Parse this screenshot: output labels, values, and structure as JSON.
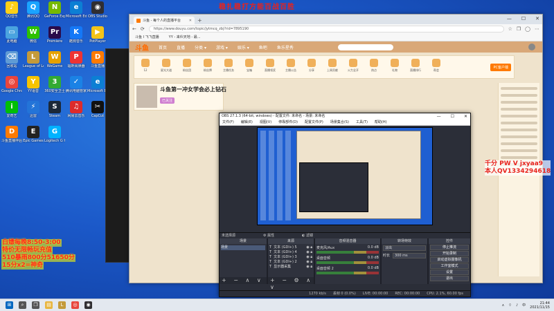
{
  "overlay": {
    "title": "稳扎稳打方能百战百胜",
    "left_lines": [
      "白嫖每晚8:50-3:00",
      "特价无限畅玩充值",
      "510暴雨800分51650分",
      "15分x2=神奇"
    ],
    "right_lines": [
      "千分 PW V jxyaa9",
      "本人QV1334294618"
    ]
  },
  "desktop_icons": [
    {
      "label": "QQ音乐",
      "color": "#fdd017",
      "glyph": "♪"
    },
    {
      "label": "腾讯QQ",
      "color": "#1aa3ff",
      "glyph": "Q"
    },
    {
      "label": "GeForce Experience",
      "color": "#76b900",
      "glyph": "N"
    },
    {
      "label": "Microsoft Edge",
      "color": "#0c7fd4",
      "glyph": "e"
    },
    {
      "label": "OBS Studio",
      "color": "#302e31",
      "glyph": "◉"
    },
    {
      "label": "此电脑",
      "color": "#4aa3df",
      "glyph": "▭"
    },
    {
      "label": "微信",
      "color": "#2dc100",
      "glyph": "W"
    },
    {
      "label": "Premiere",
      "color": "#2a0b4a",
      "glyph": "Pr"
    },
    {
      "label": "酷狗音乐",
      "color": "#1478f7",
      "glyph": "K"
    },
    {
      "label": "PotPlayer",
      "color": "#f3c318",
      "glyph": "▶"
    },
    {
      "label": "回收站",
      "color": "#5f9bd5",
      "glyph": "⌫"
    },
    {
      "label": "League of Legends",
      "color": "#c49a3a",
      "glyph": "L"
    },
    {
      "label": "WeGame",
      "color": "#e6a100",
      "glyph": "W"
    },
    {
      "label": "福昕阅读器",
      "color": "#e33",
      "glyph": "P"
    },
    {
      "label": "斗鱼直播",
      "color": "#ff7a00",
      "glyph": "D"
    },
    {
      "label": "Google Chrome",
      "color": "#e8453c",
      "glyph": "◎"
    },
    {
      "label": "YY语音",
      "color": "#f5c400",
      "glyph": "Y"
    },
    {
      "label": "360安全卫士",
      "color": "#33aa33",
      "glyph": "3"
    },
    {
      "label": "腾讯电脑管家",
      "color": "#1b82e5",
      "glyph": "✓"
    },
    {
      "label": "Microsoft Edge",
      "color": "#0c7fd4",
      "glyph": "e"
    },
    {
      "label": "爱奇艺",
      "color": "#00be06",
      "glyph": "i"
    },
    {
      "label": "迅雷",
      "color": "#2374d8",
      "glyph": "⚡"
    },
    {
      "label": "Steam",
      "color": "#1b2838",
      "glyph": "S"
    },
    {
      "label": "网易云音乐",
      "color": "#dd2b2b",
      "glyph": "♫"
    },
    {
      "label": "CapCut",
      "color": "#111",
      "glyph": "✂"
    },
    {
      "label": "斗鱼直播伴侣",
      "color": "#ff7a00",
      "glyph": "D"
    },
    {
      "label": "Epic Games",
      "color": "#222",
      "glyph": "E"
    },
    {
      "label": "Logitech G HUB",
      "color": "#00b2ff",
      "glyph": "G"
    }
  ],
  "browser": {
    "tab_title": "斗鱼 - 每个人的直播平台",
    "url": "https://www.douyu.com/topic/jytmcq_zbj?rid=7895190",
    "bookmarks": [
      "斗鱼 Ⅰ 飞飞直播",
      "YY - 来伙天地 - 最..."
    ],
    "nav": {
      "logo": "斗鱼",
      "items": [
        "首页",
        "直播",
        "分类 ▾",
        "游戏 ▾",
        "娱乐 ▾",
        "鱼吧",
        "鱼乐星秀"
      ]
    },
    "room_items": [
      "12",
      "星光大道",
      "粉丝团",
      "粉丝牌",
      "主播任务",
      "宝箱",
      "直播领奖",
      "主播公告",
      "分享",
      "上周贡献",
      "火力全开",
      "热点",
      "礼物",
      "直播排行",
      "帮会"
    ],
    "room_badge": "PC客户端",
    "streamer_name": "斗鱼第一冲女学会必上钻石",
    "streamer_follow": "已关注"
  },
  "obs": {
    "title": "OBS 27.1.3 (64-bit, windows) - 配置文件: 未命名 - 场景: 未命名",
    "menu": [
      "文件(F)",
      "编辑(E)",
      "视图(V)",
      "停靠部件(D)",
      "配置文件(P)",
      "场景集合(S)",
      "工具(T)",
      "帮助(H)"
    ],
    "scene_bar": {
      "label": "未选择源",
      "props": "属性",
      "filters": "滤镜"
    },
    "docks": {
      "scenes": {
        "title": "场景",
        "items": [
          "场景"
        ]
      },
      "sources": {
        "title": "来源",
        "items": [
          "文本 (GDI+) 5",
          "文本 (GDI+) 4",
          "文本 (GDI+) 3",
          "文本 (GDI+) 2",
          "显示器采集"
        ]
      },
      "mixer": {
        "title": "音频混音器",
        "tracks": [
          {
            "name": "麦克风/Aux",
            "db": "0.0 dB"
          },
          {
            "name": "桌面音频",
            "db": "0.0 dB"
          },
          {
            "name": "桌面音频 2",
            "db": "0.0 dB"
          }
        ]
      },
      "transitions": {
        "title": "转场特效",
        "type": "淡出",
        "duration_label": "时长",
        "duration": "300 ms"
      },
      "controls": {
        "title": "控件",
        "buttons": [
          "停止推流",
          "开始录制",
          "启动虚拟摄像机",
          "工作室模式",
          "设置",
          "退出"
        ]
      }
    },
    "status": {
      "dropped": "丢帧 0 (0.0%)",
      "live": "LIVE: 00:00:00",
      "rec": "REC: 00:00:00",
      "cpu": "CPU: 2.1%, 60.00 fps",
      "kbps": "1270 kb/s"
    }
  },
  "taskbar": {
    "icons": [
      {
        "name": "start",
        "glyph": "⊞",
        "color": "#0067c0"
      },
      {
        "name": "search",
        "glyph": "⌕",
        "color": "#555"
      },
      {
        "name": "task-view",
        "glyph": "❐",
        "color": "#555"
      },
      {
        "name": "file-explorer",
        "glyph": "▤",
        "color": "#e8b640"
      },
      {
        "name": "league",
        "glyph": "L",
        "color": "#c49a3a"
      },
      {
        "name": "chrome",
        "glyph": "◎",
        "color": "#e8453c"
      },
      {
        "name": "obs",
        "glyph": "◉",
        "color": "#302e31"
      }
    ],
    "time": "21:44",
    "date": "2021/11/15",
    "ime": "中"
  }
}
